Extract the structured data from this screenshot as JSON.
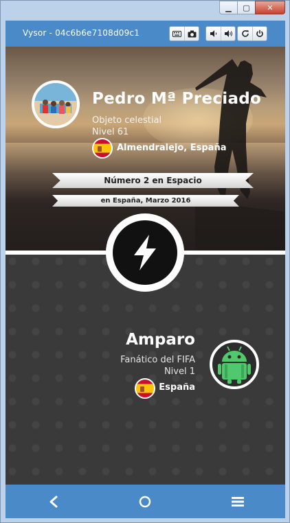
{
  "window": {
    "title": "Vysor - 04c6b6e7108d09c1",
    "controls": [
      "minimize",
      "maximize",
      "close"
    ]
  },
  "toolbar": {
    "buttons": [
      "keyboard-icon",
      "camera-icon",
      "volume-down-icon",
      "volume-up-icon",
      "rotate-icon",
      "power-icon"
    ]
  },
  "player1": {
    "name": "Pedro Mª Preciado",
    "title": "Objeto celestial",
    "level": "Nivel 61",
    "location": "Almendralejo, España",
    "rank": "Número 2 en Espacio",
    "rank_detail": "en España, Marzo 2016"
  },
  "player2": {
    "name": "Amparo",
    "title": "Fanático del FIFA",
    "level": "Nivel 1",
    "location": "España"
  },
  "badge_icon": "lightning-icon",
  "navbar": {
    "buttons": [
      "back-icon",
      "home-icon",
      "menu-icon"
    ]
  },
  "colors": {
    "accent": "#4a8ac8",
    "background": "#3a3a3a",
    "android_green": "#4fc96b"
  }
}
